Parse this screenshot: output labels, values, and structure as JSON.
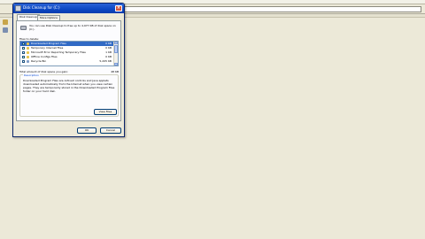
{
  "dialog": {
    "title": "Disk Cleanup for  (C:)",
    "tabs": [
      {
        "label": "Disk Cleanup"
      },
      {
        "label": "More Options"
      }
    ],
    "intro_text": "You can use Disk Cleanup to free up to 4,977 KB of disk space on (C:).",
    "files_label": "Files to delete:",
    "files": [
      {
        "name": "Downloaded Program Files",
        "size": "0 KB",
        "checked": true,
        "selected": true,
        "icon_color": "#e6c34a"
      },
      {
        "name": "Temporary Internet Files",
        "size": "0 KB",
        "checked": true,
        "selected": false,
        "icon_color": "#e6c34a"
      },
      {
        "name": "Microsoft Error Reporting Temporary Files",
        "size": "1 KB",
        "checked": false,
        "selected": false,
        "icon_color": "#e6c34a"
      },
      {
        "name": "Offline Configs Files",
        "size": "0 KB",
        "checked": true,
        "selected": false,
        "icon_color": "#e6c34a"
      },
      {
        "name": "Recycle Bin",
        "size": "5,205 KB",
        "checked": false,
        "selected": false,
        "icon_color": "#7d9bc7"
      }
    ],
    "total_label": "Total amount of disk space you gain:",
    "total_value": "48 KB",
    "description_legend": "Description",
    "description_text": "Downloaded Program Files are ActiveX controls and Java applets downloaded automatically from the Internet when you view certain pages. They are temporarily stored in the Downloaded Program Files folder on your hard disk.",
    "view_files_label": "View Files",
    "ok_label": "OK",
    "cancel_label": "Cancel"
  },
  "colors": {
    "titlebar": "#0b47c3",
    "selection": "#316ac5",
    "background": "#ece9d8"
  }
}
